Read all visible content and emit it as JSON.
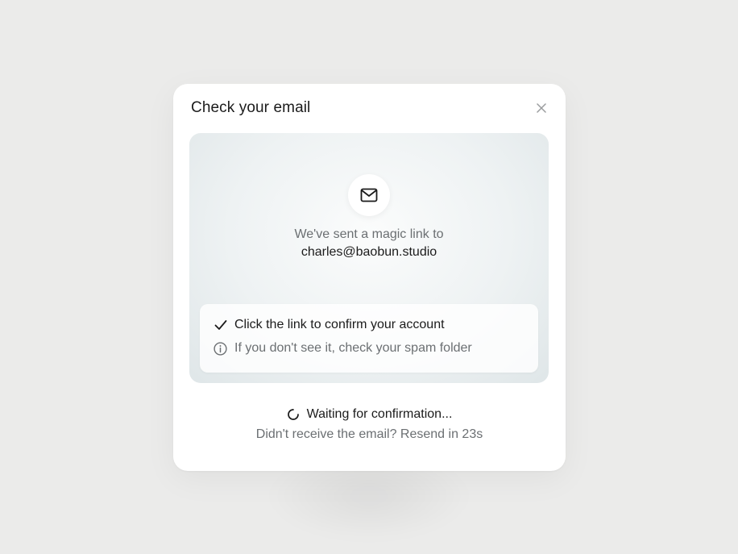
{
  "modal": {
    "title": "Check your email",
    "close_icon": "close-icon"
  },
  "panel": {
    "icon": "mail-icon",
    "sent_text": "We've sent a magic link to",
    "email": "charles@baobun.studio"
  },
  "info": {
    "items": [
      {
        "icon": "check-icon",
        "text": "Click the link to confirm your account"
      },
      {
        "icon": "info-icon",
        "text": "If you don't see it, check your spam folder"
      }
    ]
  },
  "status": {
    "icon": "spinner-icon",
    "waiting_text": "Waiting for confirmation...",
    "resend_text": "Didn't receive the email? Resend in 23s"
  }
}
